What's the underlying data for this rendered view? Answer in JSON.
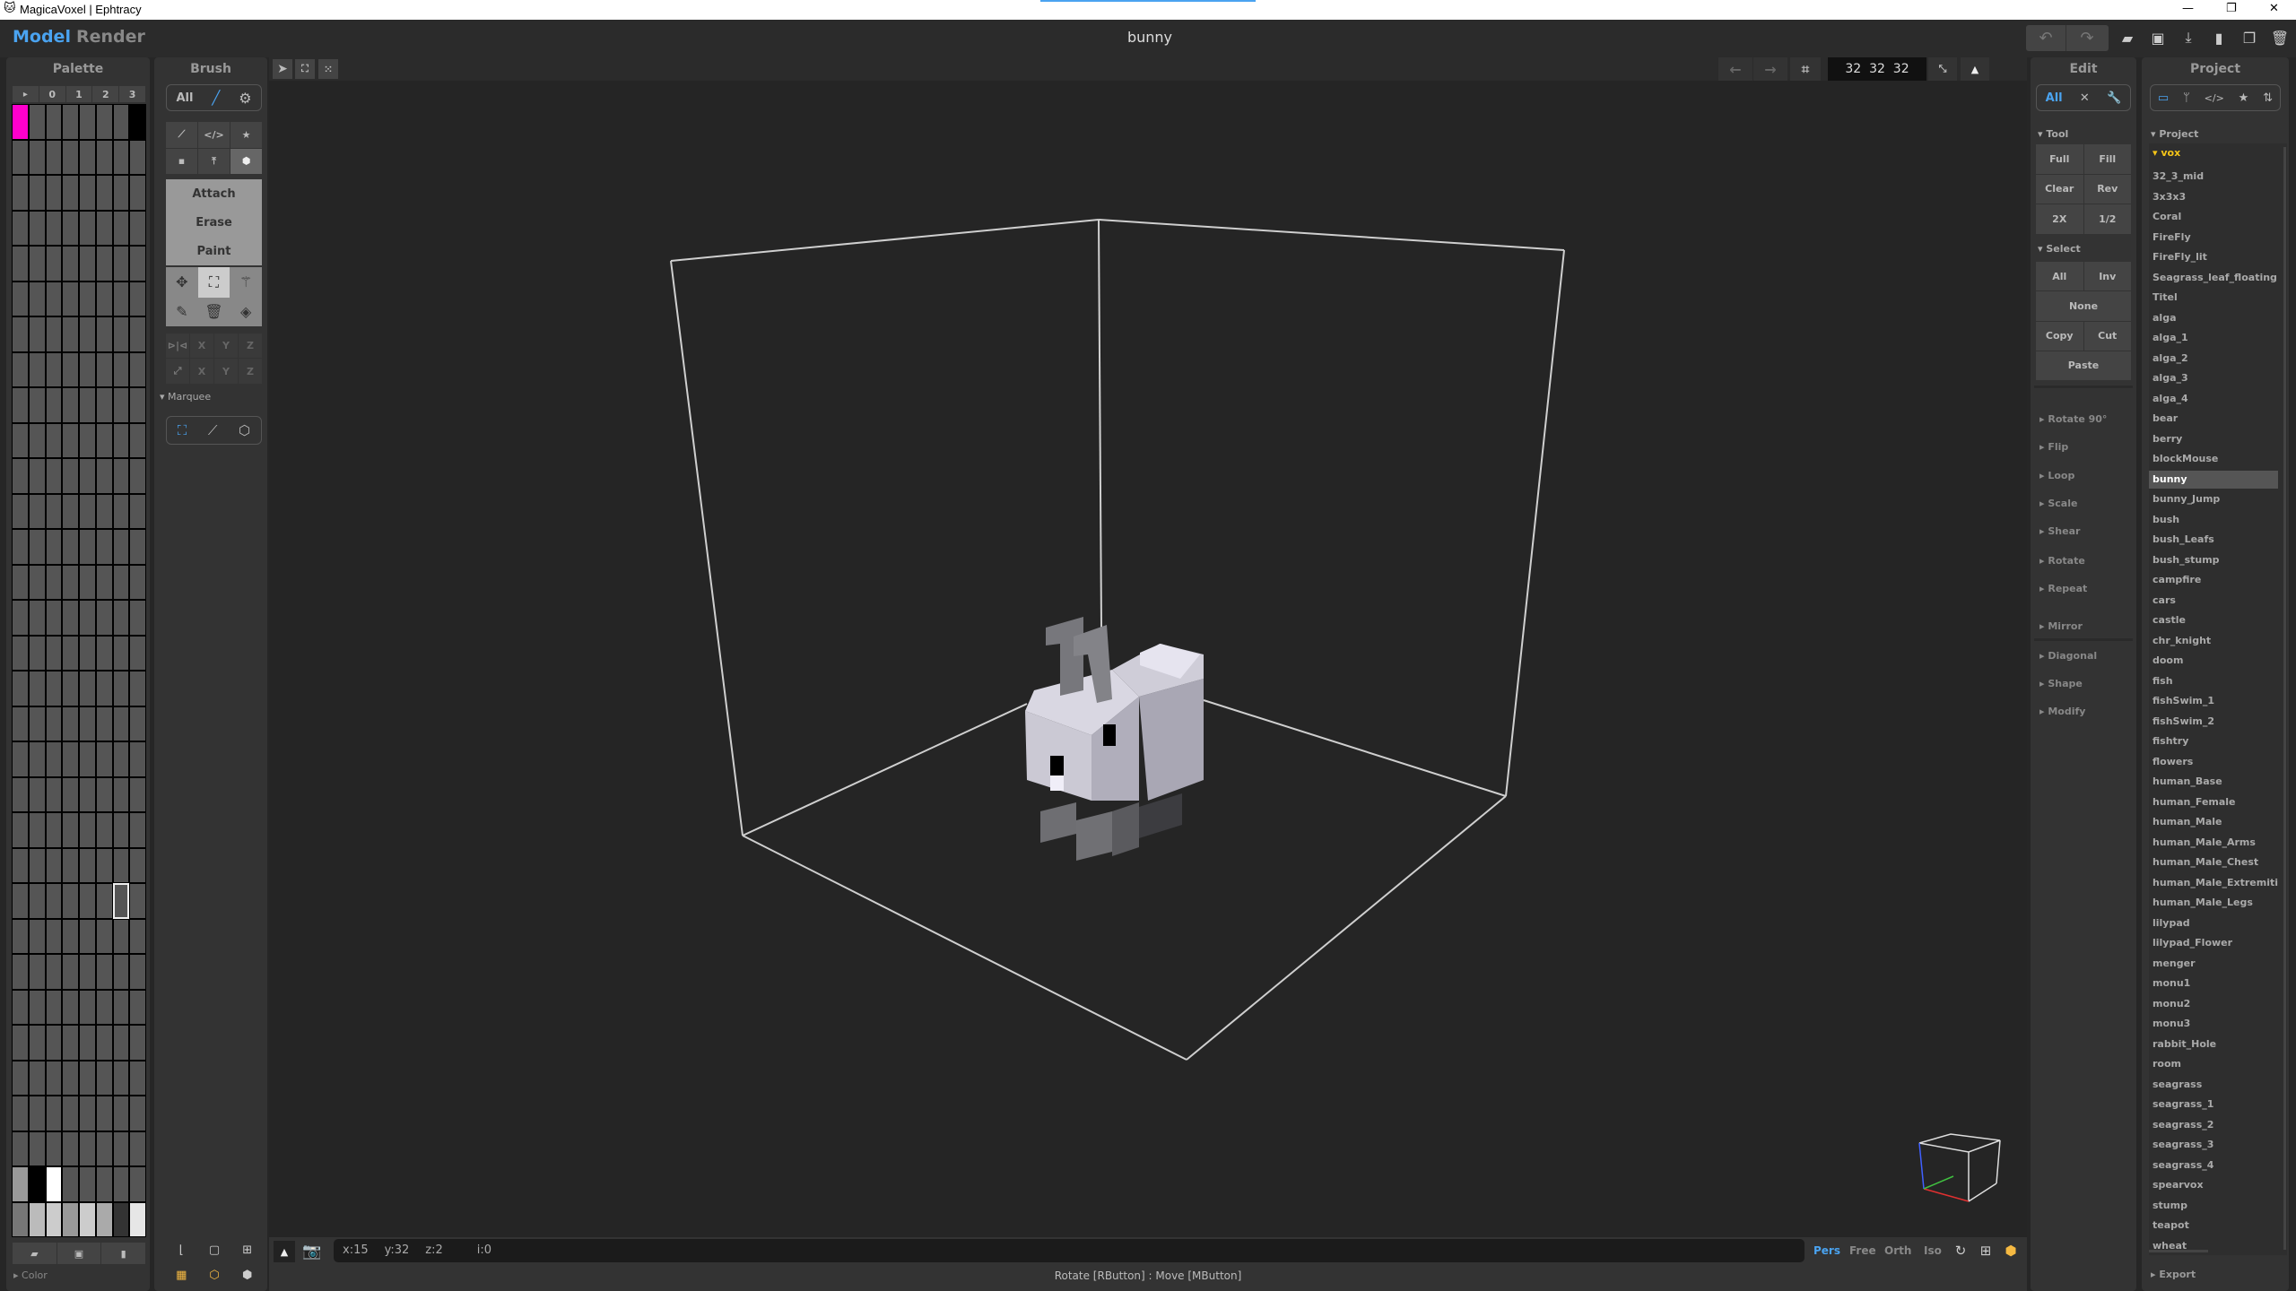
{
  "window": {
    "title": "MagicaVoxel | Ephtracy",
    "minimize": "—",
    "maximize": "❐",
    "close": "✕"
  },
  "appbar": {
    "tabs": [
      {
        "label": "Model",
        "active": true
      },
      {
        "label": "Render",
        "active": false
      }
    ],
    "document_title": "bunny",
    "undo": "↶",
    "redo": "↷",
    "icons": [
      "open-folder-icon",
      "save-icon",
      "export-icon",
      "new-file-icon",
      "duplicate-icon",
      "delete-icon"
    ]
  },
  "palette": {
    "title": "Palette",
    "tabs": [
      "▸",
      "0",
      "1",
      "2",
      "3"
    ],
    "selected_color": "#ff00cc",
    "footer_icons": [
      "open-icon",
      "save-icon",
      "new-icon"
    ],
    "color_section": "Color"
  },
  "brush": {
    "title": "Brush",
    "filter_all": "All",
    "modes": [
      "Attach",
      "Erase",
      "Paint"
    ],
    "axis_rows": [
      [
        "X",
        "Y",
        "Z"
      ],
      [
        "X",
        "Y",
        "Z"
      ]
    ],
    "marquee_label": "Marquee",
    "accent": "#4aa3f0"
  },
  "viewport": {
    "dimensions": "32  32  32",
    "coords": {
      "x": "x:15",
      "y": "y:32",
      "z": "z:2",
      "i": "i:0"
    },
    "views": [
      {
        "label": "Pers",
        "active": true
      },
      {
        "label": "Free",
        "active": false
      },
      {
        "label": "Orth",
        "active": false
      },
      {
        "label": "Iso",
        "active": false
      }
    ],
    "status": "Rotate [RButton] : Move [MButton]",
    "back_arrow": "←",
    "forward_arrow": "→"
  },
  "edit": {
    "title": "Edit",
    "filter_all": "All",
    "tool_header": "Tool",
    "tool_buttons": [
      [
        "Full",
        "Fill"
      ],
      [
        "Clear",
        "Rev"
      ],
      [
        "2X",
        "1/2"
      ]
    ],
    "select_header": "Select",
    "select_buttons": {
      "all": "All",
      "inv": "Inv",
      "none": "None",
      "copy": "Copy",
      "cut": "Cut",
      "paste": "Paste"
    },
    "sections": [
      "Rotate 90°",
      "Flip",
      "Loop",
      "Scale",
      "Shear",
      "Rotate",
      "Repeat",
      "Mirror",
      "Diagonal",
      "Shape",
      "Modify"
    ]
  },
  "project": {
    "title": "Project",
    "section": "Project",
    "folder": "vox",
    "selected": "bunny",
    "export": "Export",
    "items": [
      "32_3_mid",
      "3x3x3",
      "Coral",
      "FireFly",
      "FireFly_lit",
      "Seagrass_leaf_floating",
      "Titel",
      "alga",
      "alga_1",
      "alga_2",
      "alga_3",
      "alga_4",
      "bear",
      "berry",
      "blockMouse",
      "bunny",
      "bunny_Jump",
      "bush",
      "bush_Leafs",
      "bush_stump",
      "campfire",
      "cars",
      "castle",
      "chr_knight",
      "doom",
      "fish",
      "fishSwim_1",
      "fishSwim_2",
      "fishtry",
      "flowers",
      "human_Base",
      "human_Female",
      "human_Male",
      "human_Male_Arms",
      "human_Male_Chest",
      "human_Male_Extremiti",
      "human_Male_Legs",
      "lilypad",
      "lilypad_Flower",
      "menger",
      "monu1",
      "monu2",
      "monu3",
      "rabbit_Hole",
      "room",
      "seagrass",
      "seagrass_1",
      "seagrass_2",
      "seagrass_3",
      "seagrass_4",
      "spearvox",
      "stump",
      "teapot",
      "wheat"
    ]
  }
}
